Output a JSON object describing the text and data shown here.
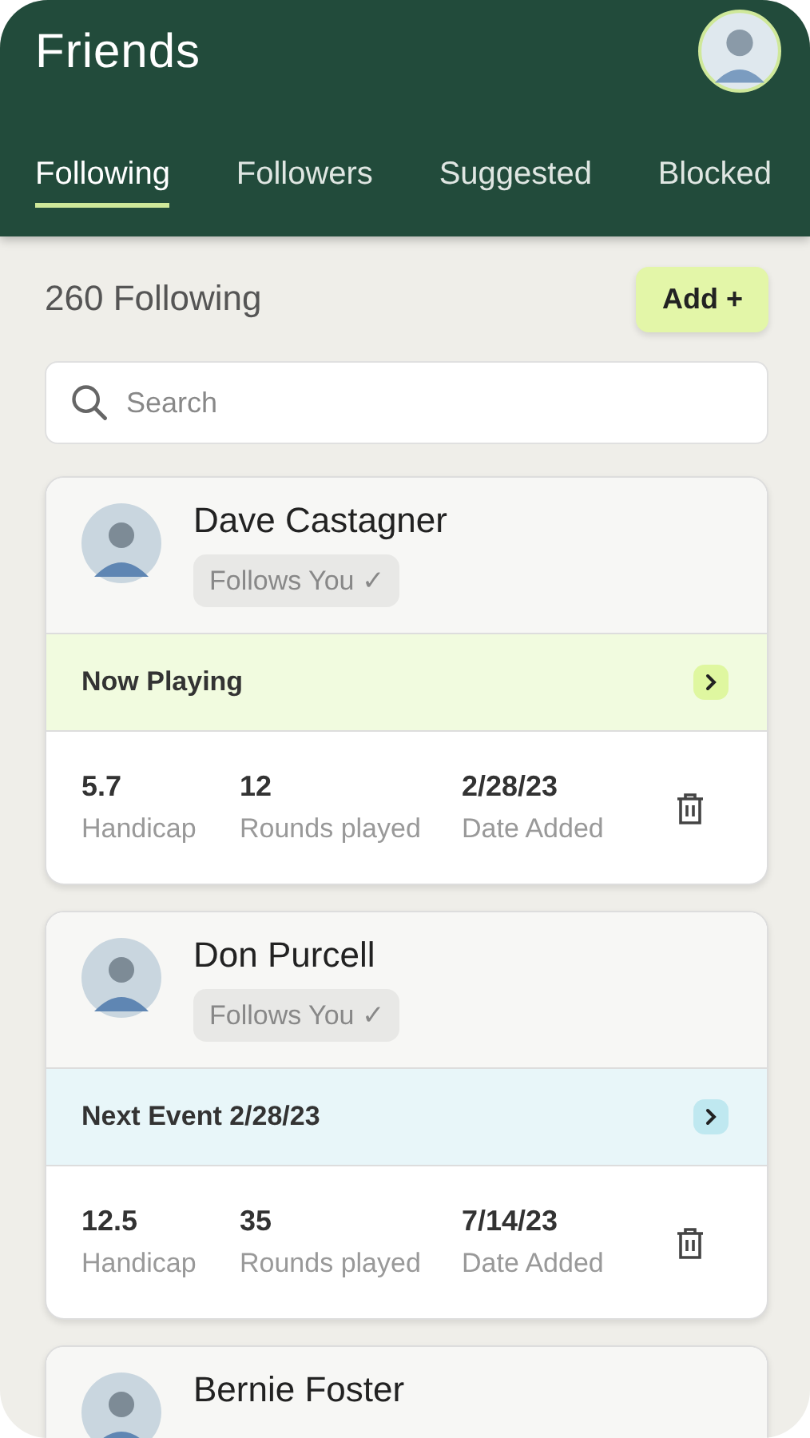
{
  "header": {
    "title": "Friends"
  },
  "tabs": [
    {
      "label": "Following",
      "selected": true
    },
    {
      "label": "Followers",
      "selected": false
    },
    {
      "label": "Suggested",
      "selected": false
    },
    {
      "label": "Blocked",
      "selected": false
    }
  ],
  "summary": {
    "count": "260 Following",
    "add_button": "Add +"
  },
  "search": {
    "placeholder": "Search"
  },
  "friends": [
    {
      "name": "Dave Castagner",
      "follows_badge": "Follows You ✓",
      "banner": {
        "kind": "playing",
        "text": "Now Playing"
      },
      "stats": [
        {
          "value": "5.7",
          "label": "Handicap"
        },
        {
          "value": "12",
          "label": "Rounds played"
        },
        {
          "value": "2/28/23",
          "label": "Date Added"
        }
      ]
    },
    {
      "name": "Don Purcell",
      "follows_badge": "Follows You ✓",
      "banner": {
        "kind": "event",
        "text": "Next Event 2/28/23"
      },
      "stats": [
        {
          "value": "12.5",
          "label": "Handicap"
        },
        {
          "value": "35",
          "label": "Rounds played"
        },
        {
          "value": "7/14/23",
          "label": "Date Added"
        }
      ]
    },
    {
      "name": "Bernie Foster"
    }
  ]
}
